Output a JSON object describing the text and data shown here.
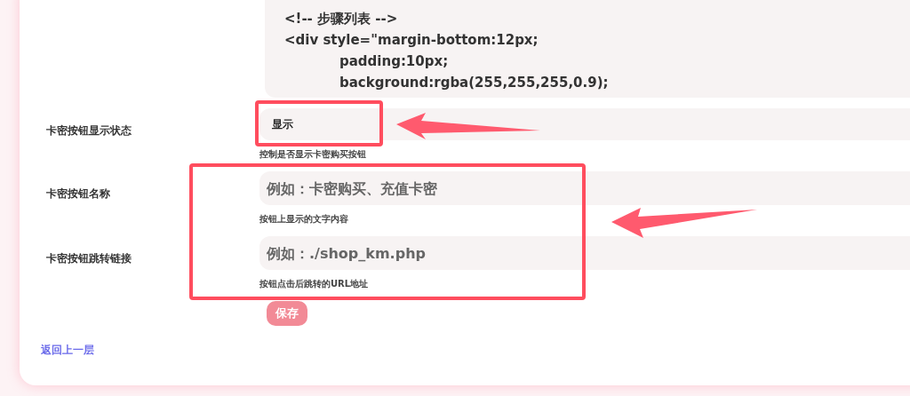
{
  "code_editor": {
    "lines": [
      {
        "text": "<!-- 步骤列表 -->",
        "indent": false
      },
      {
        "text": "<div style=\"margin-bottom:12px;",
        "indent": false
      },
      {
        "text": "padding:10px;",
        "indent": true
      },
      {
        "text": "background:rgba(255,255,255,0.9);",
        "indent": true
      }
    ]
  },
  "fields": [
    {
      "label": "卡密按钮显示状态",
      "kind": "select",
      "value": "显示",
      "hint": "控制是否显示卡密购买按钮"
    },
    {
      "label": "卡密按钮名称",
      "kind": "text",
      "placeholder": "例如：卡密购买、充值卡密",
      "hint": "按钮上显示的文字内容"
    },
    {
      "label": "卡密按钮跳转链接",
      "kind": "text",
      "placeholder": "例如：./shop_km.php",
      "hint": "按钮点击后跳转的URL地址"
    }
  ],
  "save_button": {
    "label": "保存",
    "disabled": true
  },
  "back_link": "返回上一层"
}
